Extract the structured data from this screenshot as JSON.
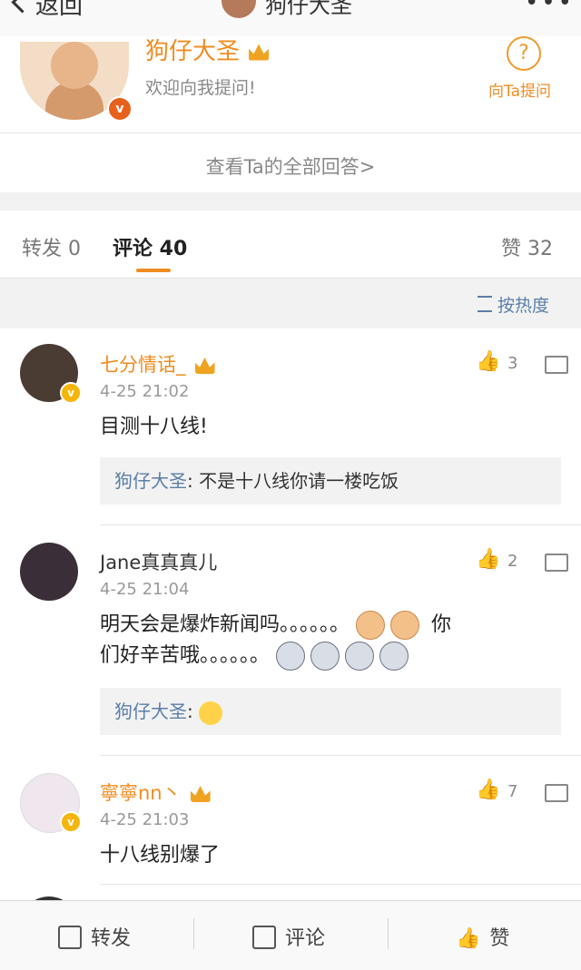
{
  "nav": {
    "back_label": "返回",
    "title": "狗仔大圣",
    "more": "•••"
  },
  "qa": {
    "name": "狗仔大圣",
    "welcome": "欢迎向我提问!",
    "ask_label": "向Ta提问",
    "ask_icon": "?",
    "view_all": "查看Ta的全部回答>"
  },
  "tabs": {
    "repost": "转发 0",
    "comment": "评论 40",
    "like": "赞 32",
    "accent": "#f08c20"
  },
  "sort": {
    "label": "按热度"
  },
  "comments": [
    {
      "name": "七分情话_",
      "time": "4-25 21:02",
      "likes": "3",
      "text": "目测十八线!",
      "reply_name": "狗仔大圣",
      "reply_text": ": 不是十八线你请一楼吃饭"
    },
    {
      "name": "Jane真真真儿",
      "time": "4-25 21:04",
      "likes": "2",
      "text1": "明天会是爆炸新闻吗。。。。。。",
      "text1b": "你",
      "text2": "们好辛苦哦。。。。。。",
      "reply_name": "狗仔大圣",
      "reply_text": ":"
    },
    {
      "name": "寧寧nn丶",
      "time": "4-25 21:03",
      "likes": "7",
      "text": "十八线别爆了"
    }
  ],
  "toolbar": {
    "repost": "转发",
    "comment": "评论",
    "like": "赞"
  },
  "colors": {
    "name_orange": "#f08c20",
    "link_blue": "#5b7ea7",
    "vip_gold": "#f5b50a"
  }
}
